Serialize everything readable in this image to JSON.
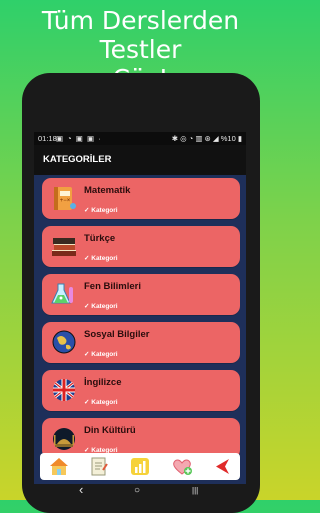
{
  "promo": {
    "line1": "Tüm Derslerden Testler",
    "line2": "Çöz!"
  },
  "status": {
    "time": "01:18",
    "left_icons": "▣ ◔ ▣ ▣ ·",
    "right_text": "✱ ◎ ◔ ▥ ⊛ ◢ %10 ▮"
  },
  "appbar": {
    "title": "KATEGORİLER"
  },
  "categories": [
    {
      "title": "Matematik",
      "sub": "✓ Kategori",
      "icon": "math-book-icon"
    },
    {
      "title": "Türkçe",
      "sub": "✓ Kategori",
      "icon": "books-icon"
    },
    {
      "title": "Fen Bilimleri",
      "sub": "✓ Kategori",
      "icon": "flask-icon"
    },
    {
      "title": "Sosyal Bilgiler",
      "sub": "✓ Kategori",
      "icon": "globe-icon"
    },
    {
      "title": "İngilizce",
      "sub": "✓ Kategori",
      "icon": "uk-flag-icon"
    },
    {
      "title": "Din Kültürü",
      "sub": "✓ Kategori",
      "icon": "mosque-icon"
    }
  ],
  "colors": {
    "card": "#ec6565",
    "screen_bg": "#1e2f5a",
    "appbar": "#111111"
  },
  "bottomnav_icons": [
    "home-icon",
    "document-icon",
    "chart-icon",
    "heart-plus-icon",
    "share-arrow-icon"
  ],
  "sysnav": {
    "back": "‹",
    "home": "○",
    "recents": "|||"
  }
}
